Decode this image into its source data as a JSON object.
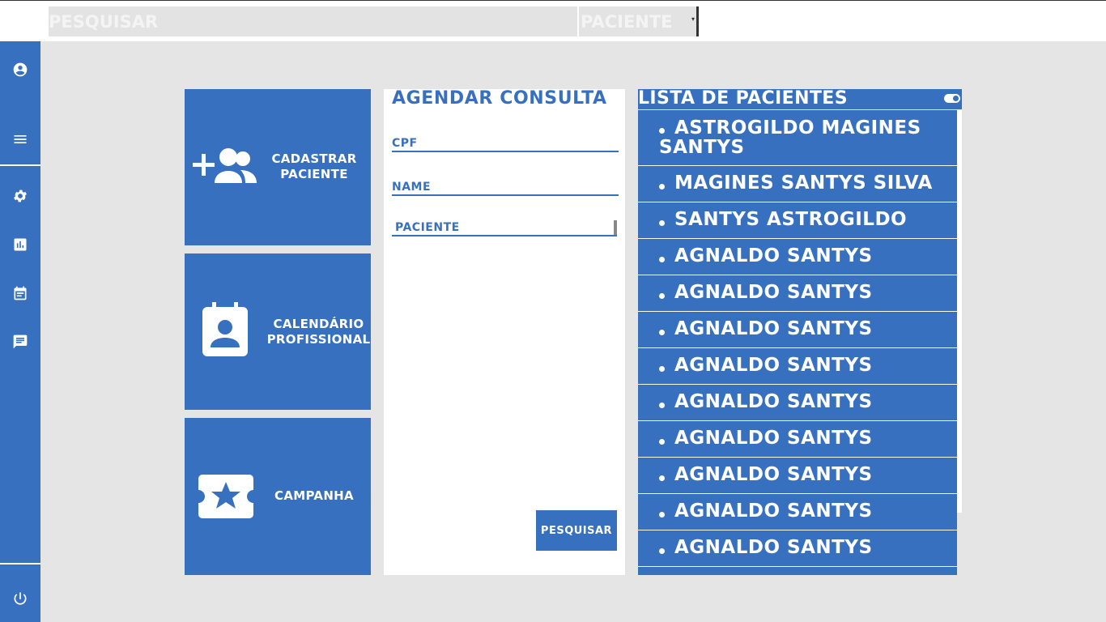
{
  "topbar": {
    "search_placeholder": "PESQUISAR",
    "type_select_value": "PACIENTE"
  },
  "sidebar": {
    "icons": [
      "account-circle-icon",
      "menu-icon",
      "gear-icon",
      "chart-icon",
      "calendar-icon",
      "chat-icon",
      "power-icon"
    ]
  },
  "tiles": {
    "cadastrar": "CADASTRAR PACIENTE",
    "cadastrar_l1": "CADASTRAR",
    "cadastrar_l2": "PACIENTE",
    "calendario_l1": "CALENDÁRIO",
    "calendario_l2": "PROFISSIONAL",
    "campanha": "CAMPANHA"
  },
  "form": {
    "title": "AGENDAR CONSULTA",
    "cpf_label": "CPF",
    "name_label": "NAME",
    "type_value": "PACIENTE",
    "search_button": "PESQUISAR"
  },
  "patients": {
    "title": "LISTA DE PACIENTES",
    "items": [
      "ASTROGILDO MAGINES SANTYS",
      "MAGINES SANTYS SILVA",
      "SANTYS ASTROGILDO",
      "AGNALDO SANTYS",
      "AGNALDO SANTYS",
      "AGNALDO SANTYS",
      "AGNALDO SANTYS",
      "AGNALDO SANTYS",
      "AGNALDO SANTYS",
      "AGNALDO SANTYS",
      "AGNALDO SANTYS",
      "AGNALDO SANTYS"
    ]
  },
  "colors": {
    "primary": "#3870c0",
    "background": "#e5e5e5",
    "white": "#ffffff"
  }
}
